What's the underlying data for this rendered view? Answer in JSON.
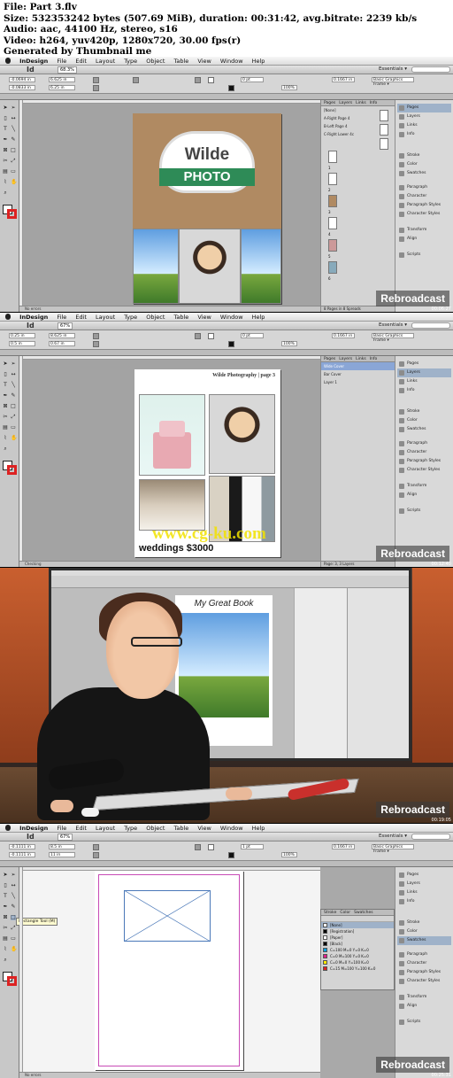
{
  "header": {
    "file": "File: Part 3.flv",
    "size": "Size: 532353242 bytes (507.69 MiB), duration: 00:31:42, avg.bitrate: 2239 kb/s",
    "audio": "Audio: aac, 44100 Hz, stereo, s16",
    "video": "Video: h264, yuv420p, 1280x720, 30.00 fps(r)",
    "generated": "Generated by Thumbnail me"
  },
  "menu": {
    "app": "InDesign",
    "items": [
      "File",
      "Edit",
      "Layout",
      "Type",
      "Object",
      "Table",
      "View",
      "Window",
      "Help"
    ]
  },
  "app": {
    "logo": "Id",
    "zoom": "68.3%",
    "essentials": "Essentials ▾",
    "preset": "Basic Graphics Frame ▾"
  },
  "watermark": "Rebroadcast",
  "site_watermark": "www.cg-ku.com",
  "frames": [
    {
      "tabs": [
        "*Untitled-8 @ 67%",
        "*Wilde Book.indd @ 68%"
      ],
      "zoom": "68.3%",
      "panel_tabs": [
        "Pages",
        "Layers",
        "Links",
        "Info"
      ],
      "panel_rows": [
        "[None]",
        "A-Right Page 4",
        "B-Left Page 4",
        "C-Right Lower 4c"
      ],
      "panel_footer": "8 Pages in 8 Spreads",
      "page_numbers": [
        "1",
        "2",
        "3",
        "4",
        "5",
        "6"
      ],
      "status": "No errors",
      "ctrl": {
        "x": "-0.0694 in",
        "y": "-0.0833 in",
        "w": "6.625 in",
        "h": "6.25 in",
        "stroke": "0 pt",
        "opacity": "100%",
        "size": "0.1667 in"
      },
      "logo": {
        "top": "Wilde",
        "bottom": "PHOTO"
      }
    },
    {
      "tabs": [
        "*Untitled-8 @ 67%",
        "*Wilde Book.indd @ 67%"
      ],
      "zoom": "67%",
      "panel_tabs": [
        "Pages",
        "Layers",
        "Links",
        "Info"
      ],
      "panel_rows": [
        "Wide Cover",
        "Bar Cover",
        "Layer 1"
      ],
      "panel_footer": "Page: 3, 3 Layers",
      "status": "Checking",
      "ctrl": {
        "x": "0.25 in",
        "y": "0.5 in",
        "w": "8.625 in",
        "h": "0.67 in",
        "stroke": "0 pt",
        "opacity": "100%",
        "size": "0.1667 in"
      },
      "page_title": "Wilde Photography",
      "page_num": "page 3",
      "caption": "weddings $3000"
    },
    {
      "book_title": "My Great Book"
    },
    {
      "tabs": [
        "*Untitled-8 @ 67%",
        "*Wilde Book.indd @ 67%",
        "Untitled-10 @ 68%",
        "*Untitled-11 @ 67%"
      ],
      "zoom": "67%",
      "tooltip": "Rectangle Tool (M)",
      "panel_tabs": [
        "Stroke",
        "Color",
        "Swatches"
      ],
      "swatches": [
        "[None]",
        "[Registration]",
        "[Paper]",
        "[Black]",
        "C=100 M=0 Y=0 K=0",
        "C=0 M=100 Y=0 K=0",
        "C=0 M=0 Y=100 K=0",
        "C=15 M=100 Y=100 K=0"
      ],
      "status": "No errors",
      "ctrl": {
        "x": "-0.1111 in",
        "y": "-0.1111 in",
        "w": "8.5 in",
        "h": "11 in",
        "stroke": "1 pt",
        "opacity": "100%",
        "size": "0.1667 in"
      }
    }
  ],
  "dock": [
    "Pages",
    "Layers",
    "Links",
    "Info",
    "Stroke",
    "Color",
    "Swatches",
    "Paragraph",
    "Character",
    "Paragraph Styles",
    "Character Styles",
    "Transform",
    "Align",
    "Scripts"
  ],
  "timecodes": [
    "00:06:27",
    "00:12:40",
    "00:19:05",
    "00:25:31"
  ],
  "colors": {
    "accent": "#2e8b57",
    "selection": "#9fb2c9",
    "magenta_guide": "#c84bb6",
    "page_bg": "#a3a3a3"
  }
}
